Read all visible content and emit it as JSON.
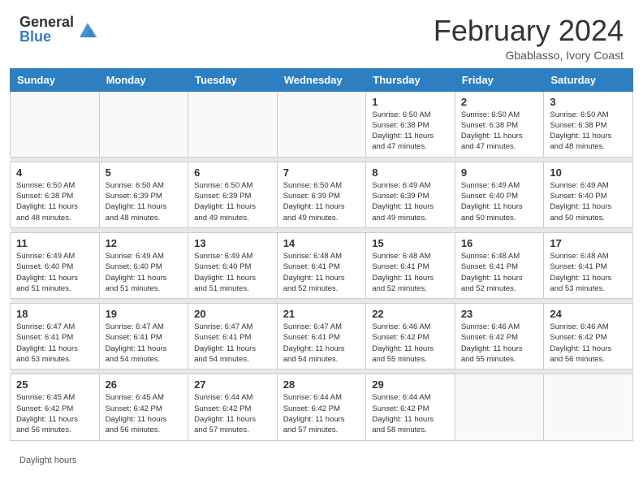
{
  "header": {
    "logo_general": "General",
    "logo_blue": "Blue",
    "main_title": "February 2024",
    "subtitle": "Gbablasso, Ivory Coast"
  },
  "footer": {
    "daylight_label": "Daylight hours"
  },
  "days_of_week": [
    "Sunday",
    "Monday",
    "Tuesday",
    "Wednesday",
    "Thursday",
    "Friday",
    "Saturday"
  ],
  "weeks": [
    [
      {
        "day": "",
        "info": ""
      },
      {
        "day": "",
        "info": ""
      },
      {
        "day": "",
        "info": ""
      },
      {
        "day": "",
        "info": ""
      },
      {
        "day": "1",
        "info": "Sunrise: 6:50 AM\nSunset: 6:38 PM\nDaylight: 11 hours\nand 47 minutes."
      },
      {
        "day": "2",
        "info": "Sunrise: 6:50 AM\nSunset: 6:38 PM\nDaylight: 11 hours\nand 47 minutes."
      },
      {
        "day": "3",
        "info": "Sunrise: 6:50 AM\nSunset: 6:38 PM\nDaylight: 11 hours\nand 48 minutes."
      }
    ],
    [
      {
        "day": "4",
        "info": "Sunrise: 6:50 AM\nSunset: 6:38 PM\nDaylight: 11 hours\nand 48 minutes."
      },
      {
        "day": "5",
        "info": "Sunrise: 6:50 AM\nSunset: 6:39 PM\nDaylight: 11 hours\nand 48 minutes."
      },
      {
        "day": "6",
        "info": "Sunrise: 6:50 AM\nSunset: 6:39 PM\nDaylight: 11 hours\nand 49 minutes."
      },
      {
        "day": "7",
        "info": "Sunrise: 6:50 AM\nSunset: 6:39 PM\nDaylight: 11 hours\nand 49 minutes."
      },
      {
        "day": "8",
        "info": "Sunrise: 6:49 AM\nSunset: 6:39 PM\nDaylight: 11 hours\nand 49 minutes."
      },
      {
        "day": "9",
        "info": "Sunrise: 6:49 AM\nSunset: 6:40 PM\nDaylight: 11 hours\nand 50 minutes."
      },
      {
        "day": "10",
        "info": "Sunrise: 6:49 AM\nSunset: 6:40 PM\nDaylight: 11 hours\nand 50 minutes."
      }
    ],
    [
      {
        "day": "11",
        "info": "Sunrise: 6:49 AM\nSunset: 6:40 PM\nDaylight: 11 hours\nand 51 minutes."
      },
      {
        "day": "12",
        "info": "Sunrise: 6:49 AM\nSunset: 6:40 PM\nDaylight: 11 hours\nand 51 minutes."
      },
      {
        "day": "13",
        "info": "Sunrise: 6:49 AM\nSunset: 6:40 PM\nDaylight: 11 hours\nand 51 minutes."
      },
      {
        "day": "14",
        "info": "Sunrise: 6:48 AM\nSunset: 6:41 PM\nDaylight: 11 hours\nand 52 minutes."
      },
      {
        "day": "15",
        "info": "Sunrise: 6:48 AM\nSunset: 6:41 PM\nDaylight: 11 hours\nand 52 minutes."
      },
      {
        "day": "16",
        "info": "Sunrise: 6:48 AM\nSunset: 6:41 PM\nDaylight: 11 hours\nand 52 minutes."
      },
      {
        "day": "17",
        "info": "Sunrise: 6:48 AM\nSunset: 6:41 PM\nDaylight: 11 hours\nand 53 minutes."
      }
    ],
    [
      {
        "day": "18",
        "info": "Sunrise: 6:47 AM\nSunset: 6:41 PM\nDaylight: 11 hours\nand 53 minutes."
      },
      {
        "day": "19",
        "info": "Sunrise: 6:47 AM\nSunset: 6:41 PM\nDaylight: 11 hours\nand 54 minutes."
      },
      {
        "day": "20",
        "info": "Sunrise: 6:47 AM\nSunset: 6:41 PM\nDaylight: 11 hours\nand 54 minutes."
      },
      {
        "day": "21",
        "info": "Sunrise: 6:47 AM\nSunset: 6:41 PM\nDaylight: 11 hours\nand 54 minutes."
      },
      {
        "day": "22",
        "info": "Sunrise: 6:46 AM\nSunset: 6:42 PM\nDaylight: 11 hours\nand 55 minutes."
      },
      {
        "day": "23",
        "info": "Sunrise: 6:46 AM\nSunset: 6:42 PM\nDaylight: 11 hours\nand 55 minutes."
      },
      {
        "day": "24",
        "info": "Sunrise: 6:46 AM\nSunset: 6:42 PM\nDaylight: 11 hours\nand 56 minutes."
      }
    ],
    [
      {
        "day": "25",
        "info": "Sunrise: 6:45 AM\nSunset: 6:42 PM\nDaylight: 11 hours\nand 56 minutes."
      },
      {
        "day": "26",
        "info": "Sunrise: 6:45 AM\nSunset: 6:42 PM\nDaylight: 11 hours\nand 56 minutes."
      },
      {
        "day": "27",
        "info": "Sunrise: 6:44 AM\nSunset: 6:42 PM\nDaylight: 11 hours\nand 57 minutes."
      },
      {
        "day": "28",
        "info": "Sunrise: 6:44 AM\nSunset: 6:42 PM\nDaylight: 11 hours\nand 57 minutes."
      },
      {
        "day": "29",
        "info": "Sunrise: 6:44 AM\nSunset: 6:42 PM\nDaylight: 11 hours\nand 58 minutes."
      },
      {
        "day": "",
        "info": ""
      },
      {
        "day": "",
        "info": ""
      }
    ]
  ]
}
